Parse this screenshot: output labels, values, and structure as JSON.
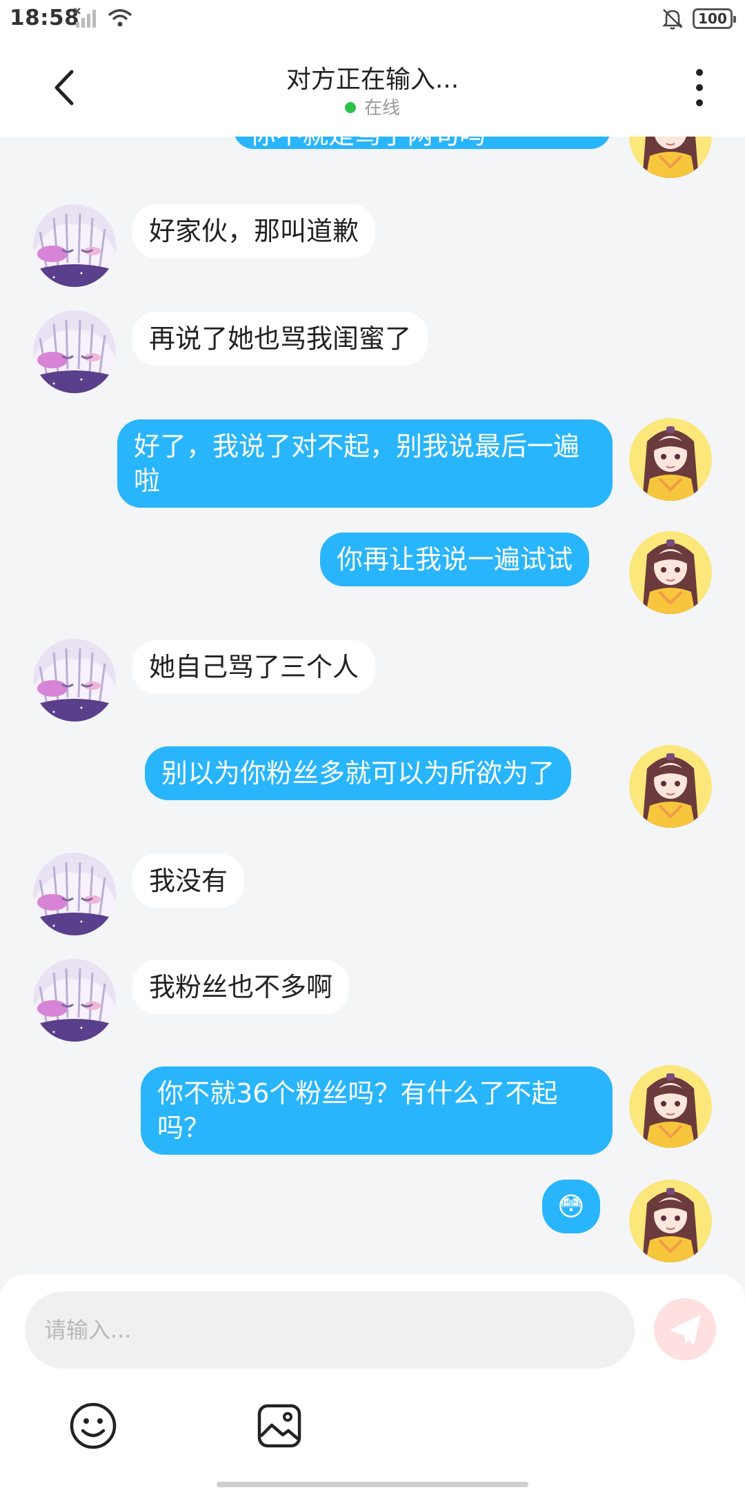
{
  "status_bar": {
    "time": "18:58",
    "battery": "100"
  },
  "header": {
    "title": "对方正在输入...",
    "status": "在线"
  },
  "messages": [
    {
      "side": "out",
      "text": "你不就是骂了两句吗",
      "partial": true
    },
    {
      "side": "in",
      "text": "好家伙，那叫道歉"
    },
    {
      "side": "in",
      "text": "再说了她也骂我闺蜜了"
    },
    {
      "side": "out",
      "text": "好了，我说了对不起，别我说最后一遍啦"
    },
    {
      "side": "out",
      "text": "你再让我说一遍试试"
    },
    {
      "side": "in",
      "text": "她自己骂了三个人"
    },
    {
      "side": "out",
      "text": "别以为你粉丝多就可以为所欲为了"
    },
    {
      "side": "in",
      "text": "我没有"
    },
    {
      "side": "in",
      "text": "我粉丝也不多啊"
    },
    {
      "side": "out",
      "text": "你不就36个粉丝吗？有什么了不起吗？"
    },
    {
      "side": "out",
      "text": "😳"
    }
  ],
  "input": {
    "placeholder": "请输入..."
  },
  "colors": {
    "outgoing_bubble": "#29b5fb",
    "incoming_bubble": "#ffffff",
    "background": "#f4f5f7",
    "online_dot": "#2bc24a",
    "send_button": "#fde0df"
  },
  "icons": {
    "back": "chevron-left-icon",
    "more": "more-vertical-icon",
    "send": "paper-plane-icon",
    "emoji": "smiley-icon",
    "image": "image-icon"
  }
}
